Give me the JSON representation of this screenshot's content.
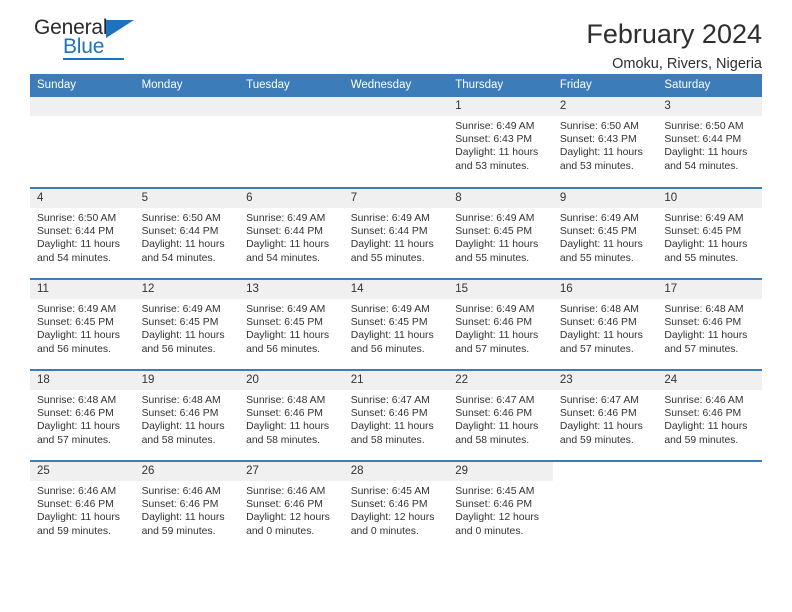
{
  "brand": {
    "name_part1": "General",
    "name_part2": "Blue",
    "triangle_icon": "triangle-icon",
    "accent_color": "#1e73be"
  },
  "header": {
    "title": "February 2024",
    "location": "Omoku, Rivers, Nigeria"
  },
  "theme": {
    "header_bar_color": "#3c7cb8",
    "date_strip_color": "#f0f0f0",
    "text_color": "#333333"
  },
  "calendar": {
    "weekdays": [
      "Sunday",
      "Monday",
      "Tuesday",
      "Wednesday",
      "Thursday",
      "Friday",
      "Saturday"
    ],
    "weeks": [
      [
        {
          "day": "",
          "lines": []
        },
        {
          "day": "",
          "lines": []
        },
        {
          "day": "",
          "lines": []
        },
        {
          "day": "",
          "lines": []
        },
        {
          "day": "1",
          "lines": [
            "Sunrise: 6:49 AM",
            "Sunset: 6:43 PM",
            "Daylight: 11 hours",
            "and 53 minutes."
          ]
        },
        {
          "day": "2",
          "lines": [
            "Sunrise: 6:50 AM",
            "Sunset: 6:43 PM",
            "Daylight: 11 hours",
            "and 53 minutes."
          ]
        },
        {
          "day": "3",
          "lines": [
            "Sunrise: 6:50 AM",
            "Sunset: 6:44 PM",
            "Daylight: 11 hours",
            "and 54 minutes."
          ]
        }
      ],
      [
        {
          "day": "4",
          "lines": [
            "Sunrise: 6:50 AM",
            "Sunset: 6:44 PM",
            "Daylight: 11 hours",
            "and 54 minutes."
          ]
        },
        {
          "day": "5",
          "lines": [
            "Sunrise: 6:50 AM",
            "Sunset: 6:44 PM",
            "Daylight: 11 hours",
            "and 54 minutes."
          ]
        },
        {
          "day": "6",
          "lines": [
            "Sunrise: 6:49 AM",
            "Sunset: 6:44 PM",
            "Daylight: 11 hours",
            "and 54 minutes."
          ]
        },
        {
          "day": "7",
          "lines": [
            "Sunrise: 6:49 AM",
            "Sunset: 6:44 PM",
            "Daylight: 11 hours",
            "and 55 minutes."
          ]
        },
        {
          "day": "8",
          "lines": [
            "Sunrise: 6:49 AM",
            "Sunset: 6:45 PM",
            "Daylight: 11 hours",
            "and 55 minutes."
          ]
        },
        {
          "day": "9",
          "lines": [
            "Sunrise: 6:49 AM",
            "Sunset: 6:45 PM",
            "Daylight: 11 hours",
            "and 55 minutes."
          ]
        },
        {
          "day": "10",
          "lines": [
            "Sunrise: 6:49 AM",
            "Sunset: 6:45 PM",
            "Daylight: 11 hours",
            "and 55 minutes."
          ]
        }
      ],
      [
        {
          "day": "11",
          "lines": [
            "Sunrise: 6:49 AM",
            "Sunset: 6:45 PM",
            "Daylight: 11 hours",
            "and 56 minutes."
          ]
        },
        {
          "day": "12",
          "lines": [
            "Sunrise: 6:49 AM",
            "Sunset: 6:45 PM",
            "Daylight: 11 hours",
            "and 56 minutes."
          ]
        },
        {
          "day": "13",
          "lines": [
            "Sunrise: 6:49 AM",
            "Sunset: 6:45 PM",
            "Daylight: 11 hours",
            "and 56 minutes."
          ]
        },
        {
          "day": "14",
          "lines": [
            "Sunrise: 6:49 AM",
            "Sunset: 6:45 PM",
            "Daylight: 11 hours",
            "and 56 minutes."
          ]
        },
        {
          "day": "15",
          "lines": [
            "Sunrise: 6:49 AM",
            "Sunset: 6:46 PM",
            "Daylight: 11 hours",
            "and 57 minutes."
          ]
        },
        {
          "day": "16",
          "lines": [
            "Sunrise: 6:48 AM",
            "Sunset: 6:46 PM",
            "Daylight: 11 hours",
            "and 57 minutes."
          ]
        },
        {
          "day": "17",
          "lines": [
            "Sunrise: 6:48 AM",
            "Sunset: 6:46 PM",
            "Daylight: 11 hours",
            "and 57 minutes."
          ]
        }
      ],
      [
        {
          "day": "18",
          "lines": [
            "Sunrise: 6:48 AM",
            "Sunset: 6:46 PM",
            "Daylight: 11 hours",
            "and 57 minutes."
          ]
        },
        {
          "day": "19",
          "lines": [
            "Sunrise: 6:48 AM",
            "Sunset: 6:46 PM",
            "Daylight: 11 hours",
            "and 58 minutes."
          ]
        },
        {
          "day": "20",
          "lines": [
            "Sunrise: 6:48 AM",
            "Sunset: 6:46 PM",
            "Daylight: 11 hours",
            "and 58 minutes."
          ]
        },
        {
          "day": "21",
          "lines": [
            "Sunrise: 6:47 AM",
            "Sunset: 6:46 PM",
            "Daylight: 11 hours",
            "and 58 minutes."
          ]
        },
        {
          "day": "22",
          "lines": [
            "Sunrise: 6:47 AM",
            "Sunset: 6:46 PM",
            "Daylight: 11 hours",
            "and 58 minutes."
          ]
        },
        {
          "day": "23",
          "lines": [
            "Sunrise: 6:47 AM",
            "Sunset: 6:46 PM",
            "Daylight: 11 hours",
            "and 59 minutes."
          ]
        },
        {
          "day": "24",
          "lines": [
            "Sunrise: 6:46 AM",
            "Sunset: 6:46 PM",
            "Daylight: 11 hours",
            "and 59 minutes."
          ]
        }
      ],
      [
        {
          "day": "25",
          "lines": [
            "Sunrise: 6:46 AM",
            "Sunset: 6:46 PM",
            "Daylight: 11 hours",
            "and 59 minutes."
          ]
        },
        {
          "day": "26",
          "lines": [
            "Sunrise: 6:46 AM",
            "Sunset: 6:46 PM",
            "Daylight: 11 hours",
            "and 59 minutes."
          ]
        },
        {
          "day": "27",
          "lines": [
            "Sunrise: 6:46 AM",
            "Sunset: 6:46 PM",
            "Daylight: 12 hours",
            "and 0 minutes."
          ]
        },
        {
          "day": "28",
          "lines": [
            "Sunrise: 6:45 AM",
            "Sunset: 6:46 PM",
            "Daylight: 12 hours",
            "and 0 minutes."
          ]
        },
        {
          "day": "29",
          "lines": [
            "Sunrise: 6:45 AM",
            "Sunset: 6:46 PM",
            "Daylight: 12 hours",
            "and 0 minutes."
          ]
        },
        {
          "day": "",
          "lines": []
        },
        {
          "day": "",
          "lines": []
        }
      ]
    ]
  }
}
